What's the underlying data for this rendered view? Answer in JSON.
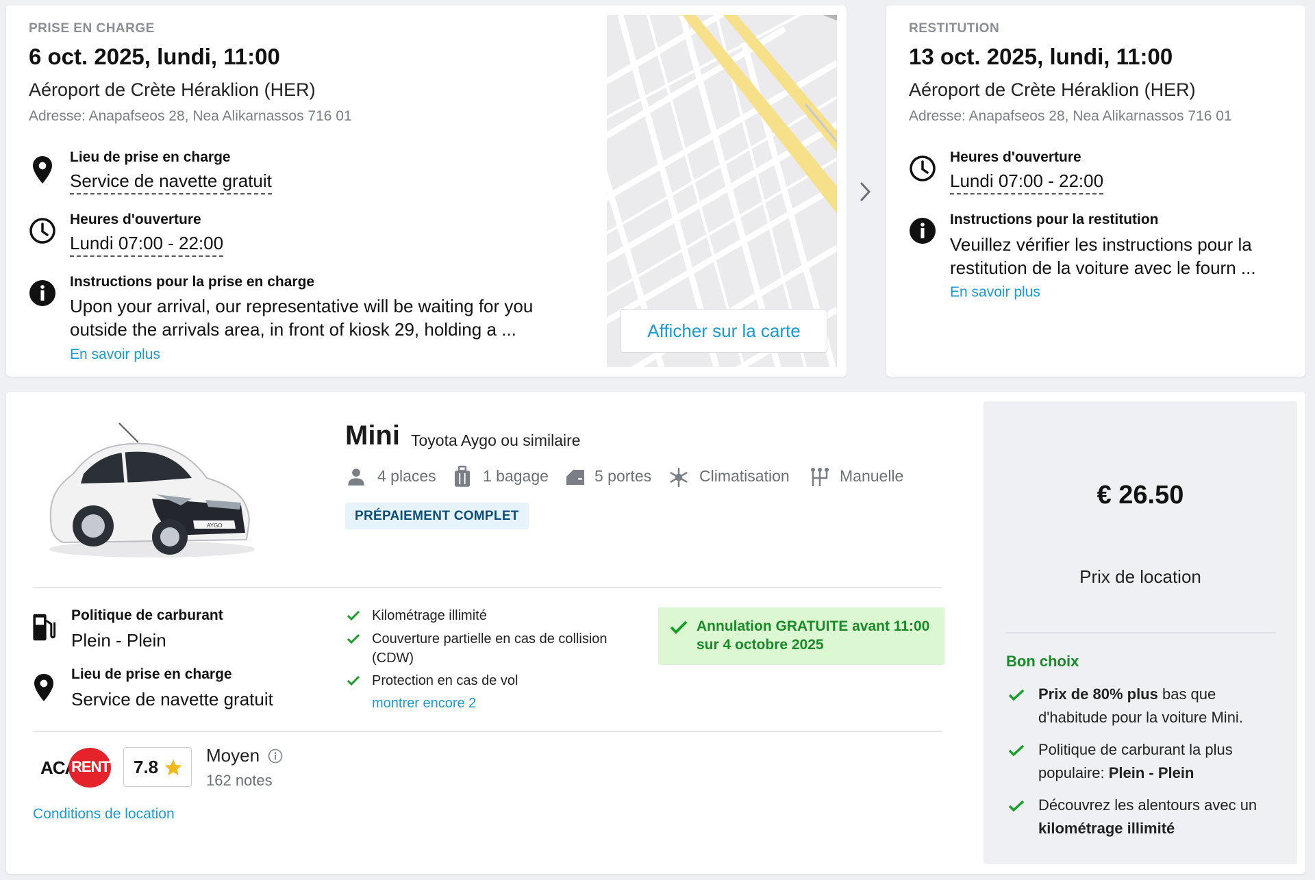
{
  "pickup": {
    "caps_label": "PRISE EN CHARGE",
    "date": "6 oct. 2025, lundi, 11:00",
    "place": "Aéroport de Crète Héraklion (HER)",
    "address": "Adresse: Anapafseos 28, Nea Alikarnassos 716 01",
    "location_label": "Lieu de prise en charge",
    "location_value": "Service de navette gratuit",
    "hours_label": "Heures d'ouverture",
    "hours_value": "Lundi 07:00 - 22:00",
    "instructions_label": "Instructions pour la prise en charge",
    "instructions_line1": "Upon your arrival, our representative will be waiting for you",
    "instructions_line2": "outside the arrivals area, in front of kiosk 29, holding a ...",
    "learn_more": "En savoir plus",
    "map_button": "Afficher sur la carte"
  },
  "return": {
    "caps_label": "RESTITUTION",
    "date": "13 oct. 2025, lundi, 11:00",
    "place": "Aéroport de Crète Héraklion (HER)",
    "address": "Adresse: Anapafseos 28, Nea Alikarnassos 716 01",
    "hours_label": "Heures d'ouverture",
    "hours_value": "Lundi 07:00 - 22:00",
    "instructions_label": "Instructions pour la restitution",
    "instructions_line1": "Veuillez vérifier les instructions pour la",
    "instructions_line2": "restitution de la voiture avec le fourn ...",
    "learn_more": "En savoir plus"
  },
  "car": {
    "category": "Mini",
    "model": "Toyota Aygo ou similaire",
    "image_badge_text": "AYGO",
    "features": {
      "seats": "4 places",
      "bags": "1 bagage",
      "doors": "5 portes",
      "ac": "Climatisation",
      "gearbox": "Manuelle"
    },
    "payment_badge": "PRÉPAIEMENT COMPLET",
    "fuel_label": "Politique de carburant",
    "fuel_value": "Plein - Plein",
    "pickup_label": "Lieu de prise en charge",
    "pickup_value": "Service de navette gratuit",
    "inclusions": [
      "Kilométrage illimité",
      "Couverture partielle en cas de collision",
      "(CDW)",
      "Protection en cas de vol"
    ],
    "show_more": "montrer encore 2",
    "cancellation_line1": "Annulation GRATUITE avant 11:00",
    "cancellation_line2": "sur 4 octobre 2025"
  },
  "supplier": {
    "logo_text_1": "ACA",
    "logo_text_2": "RENT",
    "score": "7.8",
    "rating_label": "Moyen",
    "reviews": "162 notes",
    "conditions_link": "Conditions de location"
  },
  "price": {
    "amount": "€ 26.50",
    "label": "Prix de location",
    "good_choice": "Bon choix",
    "point1_bold": "Prix de 80% plus",
    "point1_rest": " bas que",
    "point1_line2": "d'habitude pour la voiture Mini.",
    "point2_line1": "Politique de carburant la plus",
    "point2_pre": "populaire: ",
    "point2_bold": "Plein - Plein",
    "point3_line1": "Découvrez les alentours avec un",
    "point3_bold": "kilométrage illimité"
  },
  "colors": {
    "link": "#1a9ad6",
    "green": "#1a9e2a",
    "badge_bg": "#e6f3fb",
    "green_bg": "#dcf8d3"
  }
}
